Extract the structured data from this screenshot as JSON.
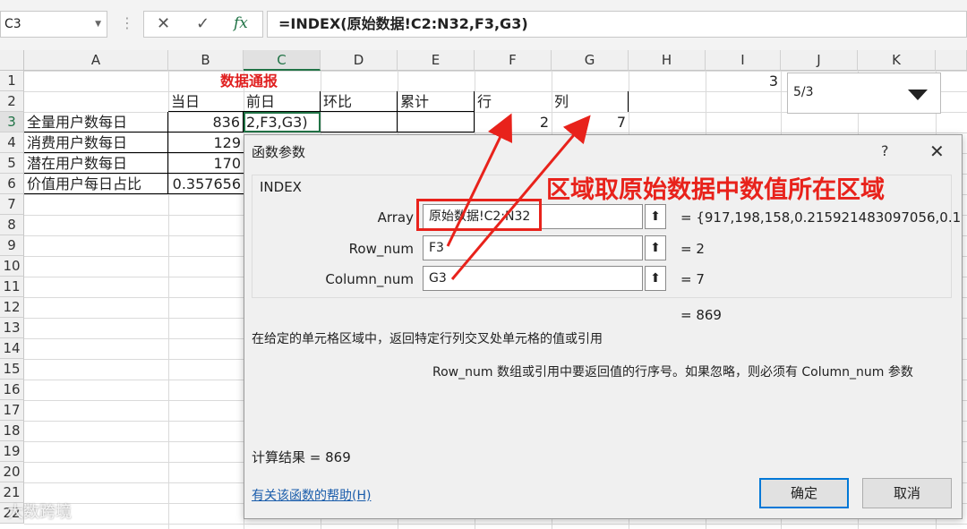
{
  "formula_bar": {
    "name_box": "C3",
    "cancel_glyph": "✕",
    "enter_glyph": "✓",
    "fx_glyph": "fx",
    "formula": "=INDEX(原始数据!C2:N32,F3,G3)"
  },
  "columns": [
    "A",
    "B",
    "C",
    "D",
    "E",
    "F",
    "G",
    "H",
    "I",
    "J",
    "K"
  ],
  "rows": [
    "1",
    "2",
    "3",
    "4",
    "5",
    "6",
    "7",
    "8",
    "9",
    "10",
    "11",
    "12",
    "13",
    "14",
    "15",
    "16",
    "17",
    "18",
    "19",
    "20",
    "21",
    "22"
  ],
  "cells": {
    "title": "数据通报",
    "b2": "当日",
    "c2": "前日",
    "d2": "环比",
    "e2": "累计",
    "f2": "行",
    "g2": "列",
    "i1": "3",
    "a3": "全量用户数每日",
    "b3": "836",
    "c3": "2,F3,G3)",
    "f3": "2",
    "g3": "7",
    "a4": "消费用户数每日",
    "b4": "129",
    "a5": "潜在用户数每日",
    "b5": "170",
    "a6": "价值用户每日占比",
    "b6": "0.357656"
  },
  "combo": {
    "value": "5/3"
  },
  "dialog": {
    "title": "函数参数",
    "help_glyph": "?",
    "close_glyph": "✕",
    "function_name": "INDEX",
    "args": [
      {
        "label": "Array",
        "value": "原始数据!C2:N32",
        "result": "=  {917,198,158,0.215921483097056,0.1"
      },
      {
        "label": "Row_num",
        "value": "F3",
        "result": "=  2"
      },
      {
        "label": "Column_num",
        "value": "G3",
        "result": "=  7"
      }
    ],
    "overall_result": "=  869",
    "description": "在给定的单元格区域中，返回特定行列交叉处单元格的值或引用",
    "arg_help": "Row_num   数组或引用中要返回值的行序号。如果忽略，则必须有 Column_num 参数",
    "calc_result": "计算结果 =   869",
    "help_link": "有关该函数的帮助(H)",
    "ok": "确定",
    "cancel": "取消"
  },
  "annotation": "区域取原始数据中数值所在区域",
  "watermark": "大数跨境",
  "colors": {
    "accent": "#217346",
    "annotation": "#e8221b",
    "title": "#e02020"
  }
}
